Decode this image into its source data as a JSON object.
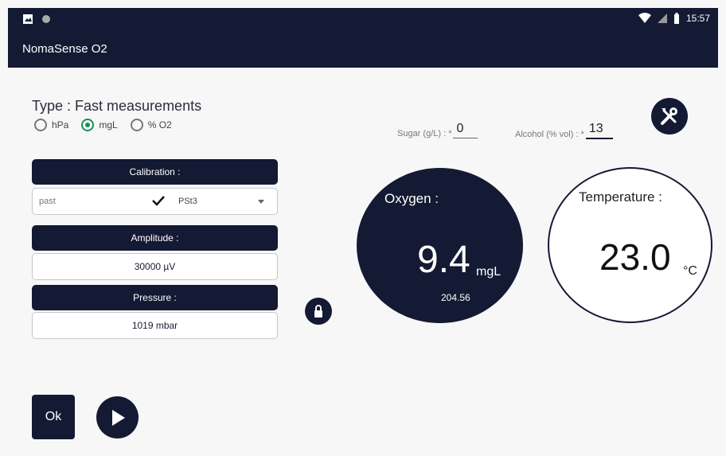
{
  "status_bar": {
    "time": "15:57"
  },
  "app": {
    "title": "NomaSense O2"
  },
  "type_line": "Type : Fast measurements",
  "units": {
    "options": [
      "hPa",
      "mgL",
      "% O2"
    ],
    "selected": "mgL"
  },
  "calibration": {
    "header": "Calibration :",
    "past": "past",
    "value": "PSt3"
  },
  "amplitude": {
    "header": "Amplitude :",
    "value": "30000 µV"
  },
  "pressure": {
    "header": "Pressure :",
    "value": "1019 mbar"
  },
  "sugar": {
    "label": "Sugar (g/L) : *",
    "value": "0"
  },
  "alcohol": {
    "label": "Alcohol (% vol) : *",
    "value": "13"
  },
  "oxygen": {
    "label": "Oxygen :",
    "value": "9.4",
    "unit": "mgL",
    "secondary": "204.56"
  },
  "temperature": {
    "label": "Temperature :",
    "value": "23.0",
    "unit": "°C"
  },
  "ok_label": "Ok",
  "icons": [
    "image-icon",
    "circle-icon",
    "wifi-icon",
    "signal-icon",
    "battery-icon",
    "lock-icon",
    "tools-icon",
    "play-icon",
    "check-icon",
    "dropdown-arrow-icon"
  ],
  "colors": {
    "navy": "#141a33",
    "selected_radio": "#1a8f56"
  }
}
